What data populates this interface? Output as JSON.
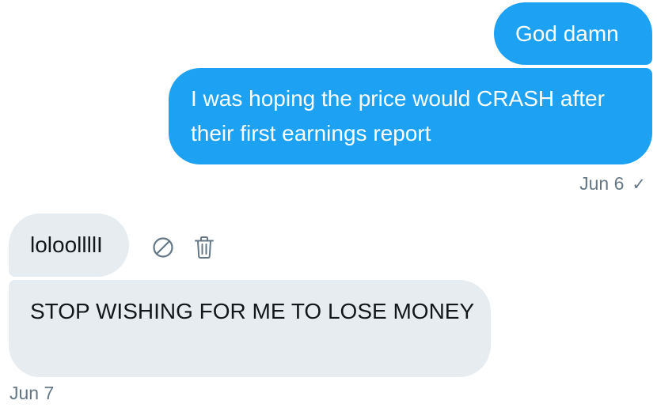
{
  "conversation": {
    "messages": [
      {
        "direction": "sent",
        "text": "God damn"
      },
      {
        "direction": "sent",
        "text": "I was hoping the price would CRASH after their first earnings report"
      },
      {
        "direction": "received",
        "text": "loloollllI"
      },
      {
        "direction": "received",
        "text": "STOP WISHING FOR ME TO LOSE MONEY"
      }
    ],
    "sent_group": {
      "date": "Jun 6",
      "status_icon": "checkmark-icon"
    },
    "received_group": {
      "date": "Jun 7"
    },
    "message_actions": {
      "icons": [
        "report-icon",
        "delete-icon"
      ]
    }
  },
  "colors": {
    "sent_bubble": "#1da1f2",
    "received_bubble": "#e6ecf0",
    "meta_text": "#657786"
  }
}
